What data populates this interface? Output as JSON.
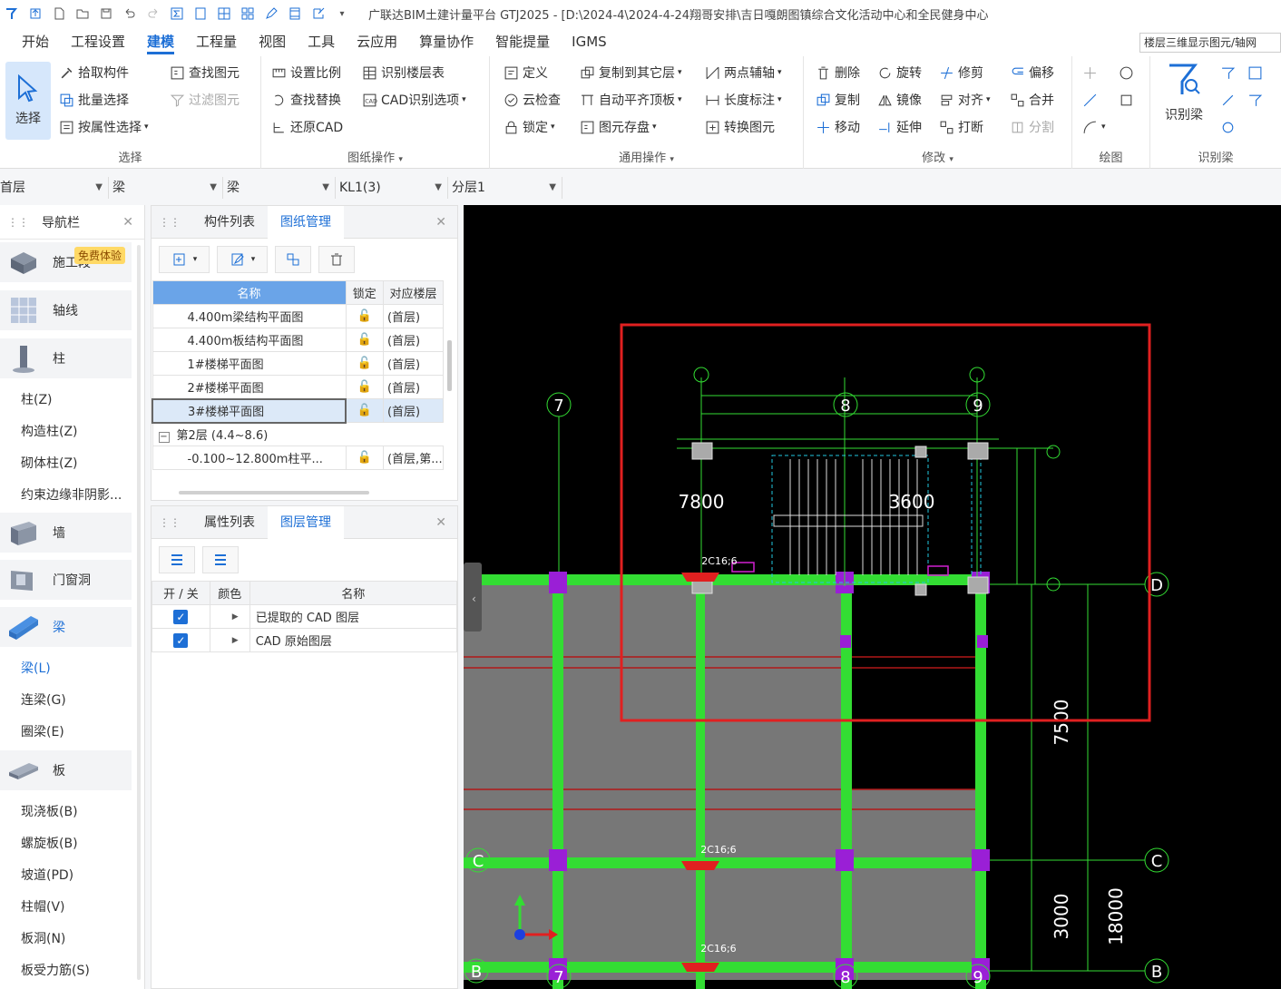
{
  "window": {
    "title": "广联达BIM土建计量平台 GTJ2025 - [D:\\2024-4\\2024-4-24翔哥安排\\吉日嘎朗图镇综合文化活动中心和全民健身中心"
  },
  "menu": {
    "tabs": [
      "开始",
      "工程设置",
      "建模",
      "工程量",
      "视图",
      "工具",
      "云应用",
      "算量协作",
      "智能提量",
      "IGMS"
    ],
    "active": "建模",
    "right_dropdown": "楼层三维显示图元/轴网"
  },
  "ribbon": {
    "select": {
      "big": "选择",
      "items": [
        "拾取构件",
        "批量选择",
        "按属性选择",
        "查找图元",
        "过滤图元"
      ],
      "label": "选择"
    },
    "drawing_ops": {
      "items": [
        "设置比例",
        "识别楼层表",
        "查找替换",
        "CAD识别选项",
        "还原CAD"
      ],
      "label": "图纸操作"
    },
    "general_ops": {
      "items": [
        "定义",
        "复制到其它层",
        "两点辅轴",
        "云检查",
        "自动平齐顶板",
        "长度标注",
        "锁定",
        "图元存盘",
        "转换图元"
      ],
      "label": "通用操作"
    },
    "modify": {
      "items": [
        "删除",
        "旋转",
        "修剪",
        "偏移",
        "复制",
        "镜像",
        "对齐",
        "合并",
        "移动",
        "延伸",
        "打断",
        "分割"
      ],
      "label": "修改"
    },
    "draw": {
      "label": "绘图"
    },
    "identify_beam": {
      "big": "识别梁",
      "label": "识别梁"
    }
  },
  "floorbar": {
    "floor": "首层",
    "type": "梁",
    "subtype": "梁",
    "component": "KL1(3)",
    "layer": "分层1"
  },
  "nav": {
    "title": "导航栏",
    "badge": "免费体验",
    "categories": [
      "施工段",
      "轴线",
      "柱",
      "墙",
      "门窗洞",
      "梁",
      "板"
    ],
    "column_items": [
      "柱(Z)",
      "构造柱(Z)",
      "砌体柱(Z)",
      "约束边缘非阴影..."
    ],
    "beam_items": [
      "梁(L)",
      "连梁(G)",
      "圈梁(E)"
    ],
    "slab_items": [
      "现浇板(B)",
      "螺旋板(B)",
      "坡道(PD)",
      "柱帽(V)",
      "板洞(N)",
      "板受力筋(S)"
    ]
  },
  "drawing_panel": {
    "tabs": [
      "构件列表",
      "图纸管理"
    ],
    "active_tab": "图纸管理",
    "columns": [
      "名称",
      "锁定",
      "对应楼层"
    ],
    "rows": [
      {
        "name": "4.400m梁结构平面图",
        "floor": "(首层)"
      },
      {
        "name": "4.400m板结构平面图",
        "floor": "(首层)"
      },
      {
        "name": "1#楼梯平面图",
        "floor": "(首层)"
      },
      {
        "name": "2#楼梯平面图",
        "floor": "(首层)"
      },
      {
        "name": "3#楼梯平面图",
        "floor": "(首层)"
      }
    ],
    "group": "第2层 (4.4~8.6)",
    "group_row": {
      "name": "-0.100~12.800m柱平...",
      "floor": "(首层,第..."
    }
  },
  "layer_panel": {
    "tabs": [
      "属性列表",
      "图层管理"
    ],
    "active_tab": "图层管理",
    "columns": [
      "开 / 关",
      "颜色",
      "名称"
    ],
    "rows": [
      {
        "name": "已提取的 CAD 图层",
        "on": true
      },
      {
        "name": "CAD 原始图层",
        "on": true
      }
    ]
  },
  "canvas": {
    "axis_labels": [
      "7",
      "8",
      "9",
      "C",
      "D",
      "B"
    ],
    "dims": [
      "7800",
      "3600",
      "7500",
      "3000",
      "18000"
    ],
    "rebar_label": "2C16;6",
    "colors": {
      "beam": "#33dd33",
      "column": "#9a1fd6",
      "highlight": "#e02020",
      "background": "#000000"
    }
  }
}
